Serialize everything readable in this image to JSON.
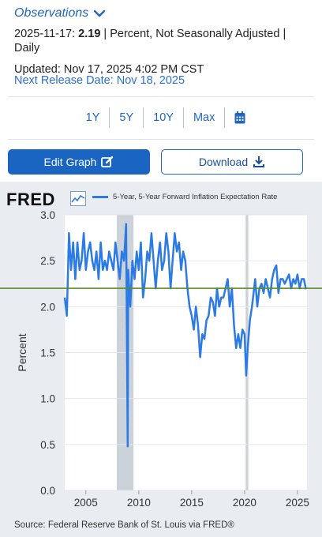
{
  "header": {
    "title": "Observations",
    "date": "2025-11-17:",
    "value": "2.19",
    "desc": " | Percent, Not Seasonally Adjusted | Daily",
    "updated": "Updated: Nov 17, 2025 4:02 PM CST",
    "next_release": "Next Release Date: Nov 18, 2025"
  },
  "range": {
    "items": [
      "1Y",
      "5Y",
      "10Y",
      "Max"
    ]
  },
  "buttons": {
    "edit": "Edit Graph",
    "download": "Download"
  },
  "chart": {
    "logo": "FRED",
    "legend": "5-Year, 5-Year Forward Inflation Expectation Rate",
    "source": "Source: Federal Reserve Bank of St. Louis via FRED®",
    "colors": {
      "line": "#2c7be5",
      "recession": "#cbd2da",
      "hline": "#5a8a2a",
      "plot_bg": "#ffffff",
      "outer_bg": "#e9edf2"
    }
  },
  "chart_data": {
    "type": "line",
    "ylabel": "Percent",
    "ylim": [
      0,
      3
    ],
    "yticks": [
      "3.0",
      "2.5",
      "2.0",
      "1.5",
      "1.0",
      "0.5",
      "0.0"
    ],
    "xlim": [
      2003,
      2025.9
    ],
    "xticks": [
      "2005",
      "2010",
      "2015",
      "2020",
      "2025"
    ],
    "recessions": [
      [
        2007.92,
        2009.5
      ],
      [
        2020.1,
        2020.35
      ]
    ],
    "reference_line": 2.2,
    "series": [
      {
        "x": [
          2003.0,
          2003.2,
          2003.4,
          2003.6,
          2003.8,
          2004.0,
          2004.2,
          2004.4,
          2004.6,
          2004.8,
          2005.0,
          2005.2,
          2005.4,
          2005.6,
          2005.8,
          2006.0,
          2006.2,
          2006.4,
          2006.6,
          2006.8,
          2007.0,
          2007.2,
          2007.4,
          2007.6,
          2007.8,
          2008.0,
          2008.2,
          2008.4,
          2008.6,
          2008.8,
          2008.95,
          2009.0,
          2009.2,
          2009.4,
          2009.6,
          2009.8,
          2010.0,
          2010.2,
          2010.4,
          2010.6,
          2010.8,
          2011.0,
          2011.2,
          2011.4,
          2011.6,
          2011.8,
          2012.0,
          2012.2,
          2012.4,
          2012.6,
          2012.8,
          2013.0,
          2013.2,
          2013.4,
          2013.6,
          2013.8,
          2014.0,
          2014.2,
          2014.4,
          2014.6,
          2014.8,
          2015.0,
          2015.2,
          2015.4,
          2015.6,
          2015.8,
          2016.0,
          2016.2,
          2016.4,
          2016.6,
          2016.8,
          2017.0,
          2017.2,
          2017.4,
          2017.6,
          2017.8,
          2018.0,
          2018.2,
          2018.4,
          2018.6,
          2018.8,
          2019.0,
          2019.2,
          2019.4,
          2019.6,
          2019.8,
          2020.0,
          2020.15,
          2020.3,
          2020.5,
          2020.7,
          2020.9,
          2021.0,
          2021.2,
          2021.4,
          2021.6,
          2021.8,
          2022.0,
          2022.2,
          2022.4,
          2022.6,
          2022.8,
          2023.0,
          2023.2,
          2023.4,
          2023.6,
          2023.8,
          2024.0,
          2024.2,
          2024.4,
          2024.6,
          2024.8,
          2025.0,
          2025.2,
          2025.4,
          2025.6,
          2025.8
        ],
        "y": [
          2.1,
          1.9,
          2.8,
          2.4,
          2.7,
          2.3,
          2.7,
          2.4,
          2.5,
          2.8,
          2.4,
          2.6,
          2.7,
          2.5,
          2.4,
          2.6,
          2.3,
          2.7,
          2.4,
          2.5,
          2.4,
          2.6,
          2.5,
          2.4,
          2.7,
          2.5,
          2.3,
          2.6,
          2.5,
          2.9,
          0.48,
          2.4,
          2.0,
          2.5,
          2.3,
          2.6,
          2.4,
          2.7,
          2.1,
          2.3,
          2.6,
          2.5,
          2.8,
          2.5,
          2.2,
          2.5,
          2.7,
          2.4,
          2.5,
          2.8,
          2.6,
          2.2,
          2.5,
          2.8,
          2.6,
          2.7,
          2.4,
          2.6,
          2.5,
          2.2,
          2.0,
          1.9,
          1.75,
          2.0,
          1.8,
          1.45,
          1.7,
          1.65,
          1.85,
          1.9,
          2.1,
          2.05,
          1.9,
          2.2,
          2.0,
          2.1,
          2.1,
          2.2,
          2.3,
          2.0,
          2.2,
          1.8,
          1.55,
          1.7,
          1.55,
          1.75,
          1.7,
          1.25,
          1.55,
          1.85,
          2.0,
          2.2,
          2.3,
          2.0,
          2.2,
          2.25,
          2.15,
          2.3,
          2.2,
          2.1,
          2.3,
          2.4,
          2.45,
          2.15,
          2.3,
          2.3,
          2.25,
          2.3,
          2.35,
          2.2,
          2.3,
          2.25,
          2.35,
          2.2,
          2.3,
          2.3,
          2.19
        ]
      }
    ]
  }
}
